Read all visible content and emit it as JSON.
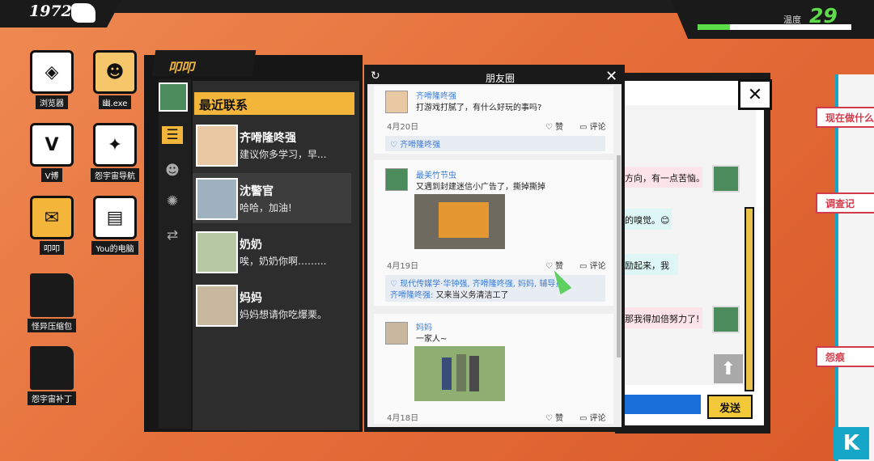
{
  "top": {
    "year": "1972",
    "temperature_label": "温度",
    "temperature_value": "29"
  },
  "desktop_icons": [
    {
      "label": "浏览器",
      "glyph": "◈"
    },
    {
      "label": "幽.exe",
      "glyph": "☻"
    },
    {
      "label": "V博",
      "glyph": "V"
    },
    {
      "label": "怨宇宙导航",
      "glyph": "✦"
    },
    {
      "label": "叩叩",
      "glyph": "✉"
    },
    {
      "label": "You的电脑",
      "glyph": "▤"
    },
    {
      "label": "怪异压缩包",
      "glyph": ""
    },
    {
      "label": "怨宇宙补丁",
      "glyph": ""
    }
  ],
  "chat": {
    "app_title": "叩叩",
    "recent_label": "最近联系",
    "contacts": [
      {
        "name": "齐嗗隆咚强",
        "message": "建议你多学习，早..."
      },
      {
        "name": "沈警官",
        "message": "哈哈，加油!"
      },
      {
        "name": "奶奶",
        "message": "唉，奶奶你啊……..."
      },
      {
        "name": "妈妈",
        "message": "妈妈想请你吃爆栗。"
      }
    ]
  },
  "moments": {
    "title": "朋友圈",
    "like_label": "赞",
    "comment_label": "评论",
    "posts": [
      {
        "author": "齐嗗隆咚强",
        "text": "打游戏打腻了，有什么好玩的事吗?",
        "date": "4月20日",
        "likes": "齐嗗隆咚强"
      },
      {
        "author": "最美竹节虫",
        "text": "又遇到封建迷信小广告了，撕掉撕掉",
        "date": "4月19日",
        "likes": "现代传媒学·华钟强, 齐嗗隆咚强, 妈妈, 辅导员",
        "comment_author": "齐嗗隆咚强:",
        "comment_text": "又来当义务清洁工了"
      },
      {
        "author": "妈妈",
        "text": "一家人~",
        "date": "4月18日"
      }
    ]
  },
  "dialog": {
    "messages": [
      "方向，有一点苦恼。",
      "的嗅觉。😊",
      "励起来，我",
      "那我得加倍努力了!"
    ],
    "send_label": "发送"
  },
  "side_tags": [
    "现在做什么",
    "调查记",
    "怨痕"
  ]
}
